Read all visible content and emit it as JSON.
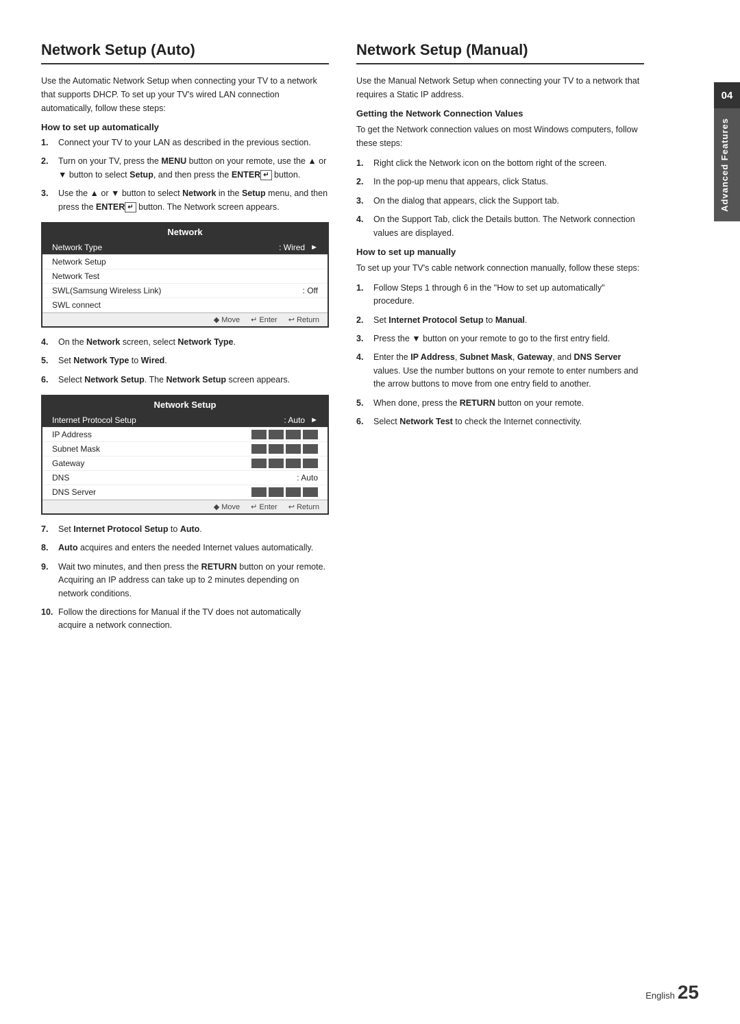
{
  "page": {
    "chapter_number": "04",
    "chapter_title": "Advanced Features",
    "page_number": "25",
    "page_label": "English"
  },
  "left_section": {
    "title": "Network Setup (Auto)",
    "intro": "Use the Automatic Network Setup when connecting your TV to a network that supports DHCP. To set up your TV's wired LAN connection automatically, follow these steps:",
    "subsection_title": "How to set up automatically",
    "steps": [
      {
        "num": "1.",
        "text": "Connect your TV to your LAN as described in the previous section."
      },
      {
        "num": "2.",
        "text": "Turn on your TV, press the MENU button on your remote, use the ▲ or ▼ button to select Setup, and then press the ENTER button."
      },
      {
        "num": "3.",
        "text": "Use the ▲ or ▼ button to select Network in the Setup menu, and then press the ENTER button. The Network screen appears."
      }
    ],
    "network_box": {
      "title": "Network",
      "rows": [
        {
          "label": "Network Type",
          "value": ": Wired",
          "arrow": true,
          "selected": true
        },
        {
          "label": "Network Setup",
          "value": "",
          "arrow": false,
          "selected": false
        },
        {
          "label": "Network Test",
          "value": "",
          "arrow": false,
          "selected": false
        },
        {
          "label": "SWL(Samsung Wireless Link)",
          "value": ": Off",
          "arrow": false,
          "selected": false
        },
        {
          "label": "SWL connect",
          "value": "",
          "arrow": false,
          "selected": false
        }
      ],
      "footer": [
        {
          "icon": "◆",
          "label": "Move"
        },
        {
          "icon": "↵",
          "label": "Enter"
        },
        {
          "icon": "↩",
          "label": "Return"
        }
      ]
    },
    "steps_after": [
      {
        "num": "4.",
        "text": "On the Network screen, select Network Type."
      },
      {
        "num": "5.",
        "text": "Set Network Type to Wired."
      },
      {
        "num": "6.",
        "text": "Select Network Setup. The Network Setup screen appears."
      }
    ],
    "network_setup_box": {
      "title": "Network Setup",
      "rows": [
        {
          "label": "Internet Protocol Setup",
          "value": ": Auto",
          "arrow": true,
          "selected": true,
          "ip_blocks": false
        },
        {
          "label": "IP Address",
          "value": "",
          "arrow": false,
          "selected": false,
          "ip_blocks": true
        },
        {
          "label": "Subnet Mask",
          "value": "",
          "arrow": false,
          "selected": false,
          "ip_blocks": true
        },
        {
          "label": "Gateway",
          "value": "",
          "arrow": false,
          "selected": false,
          "ip_blocks": true
        },
        {
          "label": "DNS",
          "value": ": Auto",
          "arrow": false,
          "selected": false,
          "ip_blocks": false
        },
        {
          "label": "DNS Server",
          "value": "",
          "arrow": false,
          "selected": false,
          "ip_blocks": true
        }
      ],
      "footer": [
        {
          "icon": "◆",
          "label": "Move"
        },
        {
          "icon": "↵",
          "label": "Enter"
        },
        {
          "icon": "↩",
          "label": "Return"
        }
      ]
    },
    "steps_final": [
      {
        "num": "7.",
        "text": "Set Internet Protocol Setup to Auto."
      },
      {
        "num": "8.",
        "text": "Auto acquires and enters the needed Internet values automatically."
      },
      {
        "num": "9.",
        "text": "Wait two minutes, and then press the RETURN button on your remote. Acquiring an IP address can take up to 2 minutes depending on network conditions."
      },
      {
        "num": "10.",
        "text": "Follow the directions for Manual if the TV does not automatically acquire a network connection."
      }
    ]
  },
  "right_section": {
    "title": "Network Setup (Manual)",
    "intro": "Use the Manual Network Setup when connecting your TV to a network that requires a Static IP address.",
    "getting_values": {
      "title": "Getting the Network Connection Values",
      "intro": "To get the Network connection values on most Windows computers, follow these steps:",
      "steps": [
        {
          "num": "1.",
          "text": "Right click the Network icon on the bottom right of the screen."
        },
        {
          "num": "2.",
          "text": "In the pop-up menu that appears, click Status."
        },
        {
          "num": "3.",
          "text": "On the dialog that appears, click the Support tab."
        },
        {
          "num": "4.",
          "text": "On the Support Tab, click the Details button. The Network connection values are displayed."
        }
      ]
    },
    "how_to_manually": {
      "title": "How to set up manually",
      "intro": "To set up your TV's cable network connection manually, follow these steps:",
      "steps": [
        {
          "num": "1.",
          "text": "Follow Steps 1 through 6 in the \"How to set up automatically\" procedure."
        },
        {
          "num": "2.",
          "text": "Set Internet Protocol Setup to Manual."
        },
        {
          "num": "3.",
          "text": "Press the ▼ button on your remote to go to the first entry field."
        },
        {
          "num": "4.",
          "text": "Enter the IP Address, Subnet Mask, Gateway, and DNS Server values. Use the number buttons on your remote to enter numbers and the arrow buttons to move from one entry field to another."
        },
        {
          "num": "5.",
          "text": "When done, press the RETURN button on your remote."
        },
        {
          "num": "6.",
          "text": "Select Network Test to check the Internet connectivity."
        }
      ]
    }
  }
}
